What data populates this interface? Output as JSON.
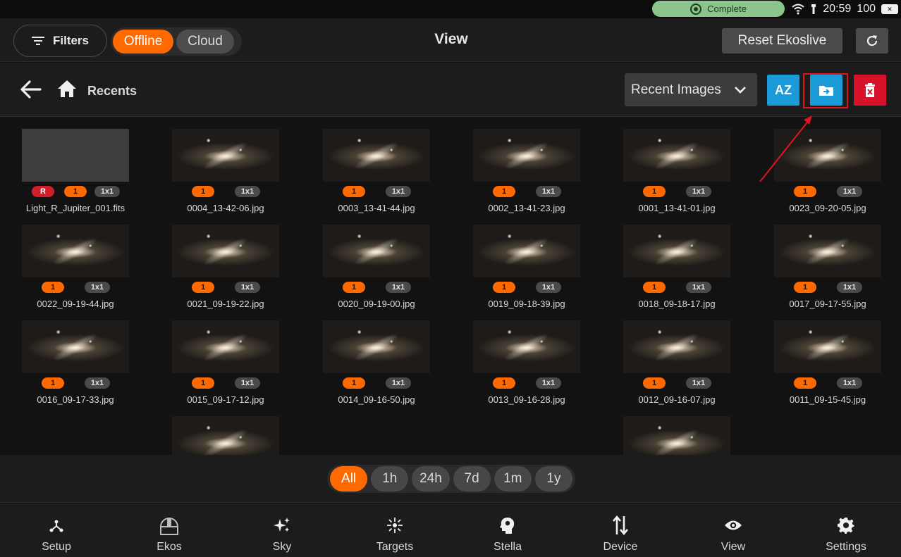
{
  "status_bar": {
    "status_label": "Complete",
    "time": "20:59",
    "battery": "100"
  },
  "header": {
    "filters_label": "Filters",
    "mode_options": [
      "Offline",
      "Cloud"
    ],
    "selected_mode": "Offline",
    "title": "View",
    "reset_label": "Reset Ekoslive"
  },
  "toolbar": {
    "breadcrumb": "Recents",
    "dropdown_value": "Recent Images",
    "sort_label": "AZ"
  },
  "gallery": {
    "items": [
      {
        "name": "Light_R_Jupiter_001.fits",
        "badges": [
          "R",
          "1",
          "1x1"
        ],
        "thumb": "gray"
      },
      {
        "name": "0004_13-42-06.jpg",
        "badges": [
          "1",
          "1x1"
        ],
        "thumb": "galaxy"
      },
      {
        "name": "0003_13-41-44.jpg",
        "badges": [
          "1",
          "1x1"
        ],
        "thumb": "galaxy"
      },
      {
        "name": "0002_13-41-23.jpg",
        "badges": [
          "1",
          "1x1"
        ],
        "thumb": "galaxy"
      },
      {
        "name": "0001_13-41-01.jpg",
        "badges": [
          "1",
          "1x1"
        ],
        "thumb": "galaxy"
      },
      {
        "name": "0023_09-20-05.jpg",
        "badges": [
          "1",
          "1x1"
        ],
        "thumb": "galaxy"
      },
      {
        "name": "0022_09-19-44.jpg",
        "badges": [
          "1",
          "1x1"
        ],
        "thumb": "galaxy"
      },
      {
        "name": "0021_09-19-22.jpg",
        "badges": [
          "1",
          "1x1"
        ],
        "thumb": "galaxy"
      },
      {
        "name": "0020_09-19-00.jpg",
        "badges": [
          "1",
          "1x1"
        ],
        "thumb": "galaxy"
      },
      {
        "name": "0019_09-18-39.jpg",
        "badges": [
          "1",
          "1x1"
        ],
        "thumb": "galaxy"
      },
      {
        "name": "0018_09-18-17.jpg",
        "badges": [
          "1",
          "1x1"
        ],
        "thumb": "galaxy"
      },
      {
        "name": "0017_09-17-55.jpg",
        "badges": [
          "1",
          "1x1"
        ],
        "thumb": "galaxy"
      },
      {
        "name": "0016_09-17-33.jpg",
        "badges": [
          "1",
          "1x1"
        ],
        "thumb": "galaxy"
      },
      {
        "name": "0015_09-17-12.jpg",
        "badges": [
          "1",
          "1x1"
        ],
        "thumb": "galaxy"
      },
      {
        "name": "0014_09-16-50.jpg",
        "badges": [
          "1",
          "1x1"
        ],
        "thumb": "galaxy"
      },
      {
        "name": "0013_09-16-28.jpg",
        "badges": [
          "1",
          "1x1"
        ],
        "thumb": "galaxy"
      },
      {
        "name": "0012_09-16-07.jpg",
        "badges": [
          "1",
          "1x1"
        ],
        "thumb": "galaxy"
      },
      {
        "name": "0011_09-15-45.jpg",
        "badges": [
          "1",
          "1x1"
        ],
        "thumb": "galaxy"
      }
    ]
  },
  "time_filter": {
    "options": [
      "All",
      "1h",
      "24h",
      "7d",
      "1m",
      "1y"
    ],
    "selected": "All"
  },
  "bottom_nav": {
    "items": [
      {
        "label": "Setup",
        "icon": "setup-icon"
      },
      {
        "label": "Ekos",
        "icon": "observatory-dome-icon"
      },
      {
        "label": "Sky",
        "icon": "sparkles-icon"
      },
      {
        "label": "Targets",
        "icon": "crosshair-icon"
      },
      {
        "label": "Stella",
        "icon": "brain-head-icon"
      },
      {
        "label": "Device",
        "icon": "transfer-arrows-icon"
      },
      {
        "label": "View",
        "icon": "eye-icon"
      },
      {
        "label": "Settings",
        "icon": "gear-icon"
      }
    ]
  },
  "colors": {
    "accent": "#ff6a00",
    "info_blue": "#1a9ad6",
    "danger_red": "#d8122a",
    "status_green": "#8bc58b",
    "annotation_red": "#e0141e"
  }
}
